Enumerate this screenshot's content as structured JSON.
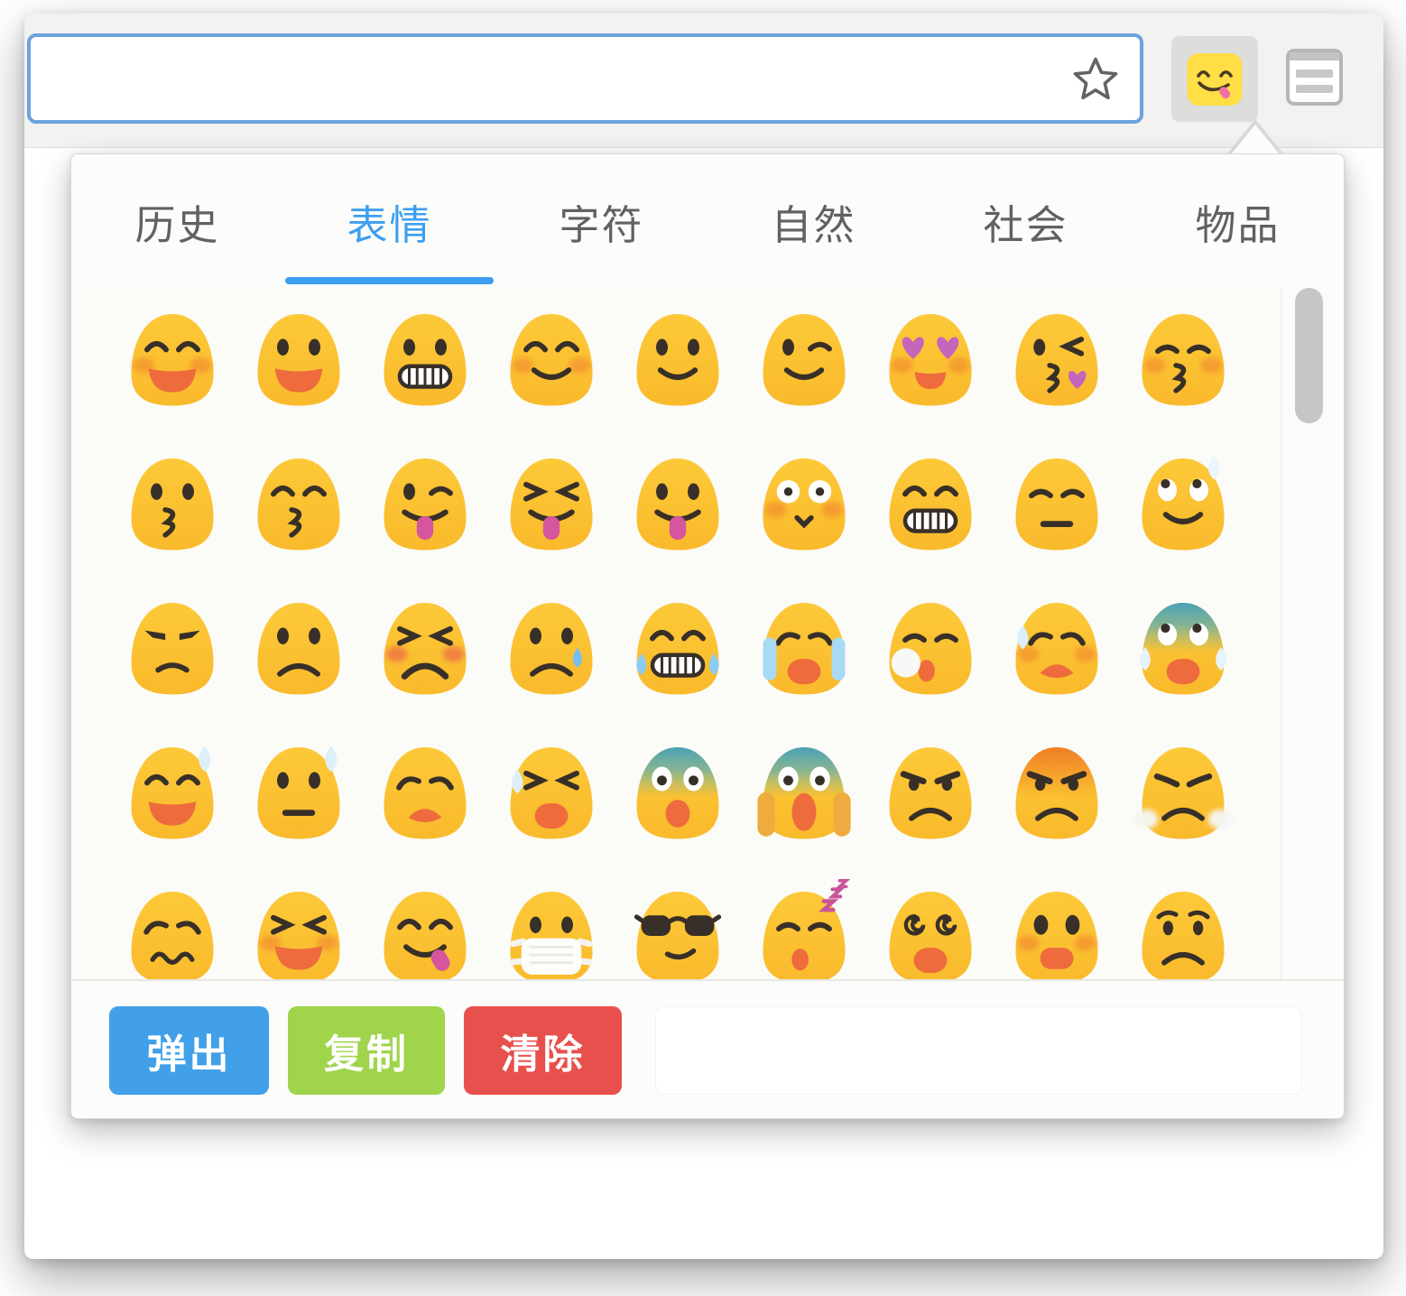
{
  "browser": {
    "toolbar": {
      "address_bar": {
        "value": "",
        "placeholder": ""
      },
      "bookmark_star_icon": "star-outline",
      "extension_button": {
        "icon": "emoji-face-tongue",
        "active": true
      },
      "menu_button": {
        "icon": "browser-menu"
      }
    }
  },
  "popup": {
    "accent_color": "#3D9FF0",
    "tabs": [
      {
        "label": "历史",
        "active": false
      },
      {
        "label": "表情",
        "active": true
      },
      {
        "label": "字符",
        "active": false
      },
      {
        "label": "自然",
        "active": false
      },
      {
        "label": "社会",
        "active": false
      },
      {
        "label": "物品",
        "active": false
      }
    ],
    "grid": {
      "columns": 9,
      "emojis": [
        {
          "char": "😄",
          "name": "smiling-face-open-mouth-smiling-eyes",
          "eyes": "happy",
          "mouth": "open-smile",
          "extras": [
            "blush"
          ]
        },
        {
          "char": "😃",
          "name": "smiling-face-open-mouth",
          "eyes": "oval",
          "mouth": "open-smile",
          "extras": []
        },
        {
          "char": "😀",
          "name": "grinning-face",
          "eyes": "oval",
          "mouth": "teeth",
          "extras": []
        },
        {
          "char": "😊",
          "name": "smiling-face-smiling-eyes",
          "eyes": "happy",
          "mouth": "smile",
          "extras": [
            "blush"
          ]
        },
        {
          "char": "☺",
          "name": "relaxed-face",
          "eyes": "oval",
          "mouth": "smile",
          "extras": []
        },
        {
          "char": "😉",
          "name": "winking-face",
          "eyes": "wink",
          "mouth": "smile",
          "extras": []
        },
        {
          "char": "😍",
          "name": "heart-eyes-face",
          "eyes": "hearts",
          "mouth": "open-smile-small",
          "extras": [
            "blush"
          ]
        },
        {
          "char": "😘",
          "name": "face-blowing-kiss",
          "eyes": "wink-kiss",
          "mouth": "kiss",
          "extras": [
            "heart"
          ]
        },
        {
          "char": "😚",
          "name": "kissing-face-closed-eyes",
          "eyes": "closed",
          "mouth": "kiss",
          "extras": [
            "blush"
          ]
        },
        {
          "char": "😗",
          "name": "kissing-face",
          "eyes": "oval",
          "mouth": "kiss",
          "extras": []
        },
        {
          "char": "😙",
          "name": "kissing-face-smiling-eyes",
          "eyes": "happy",
          "mouth": "kiss",
          "extras": []
        },
        {
          "char": "😜",
          "name": "winking-face-tongue",
          "eyes": "wink",
          "mouth": "open-tongue",
          "extras": []
        },
        {
          "char": "😝",
          "name": "squinting-face-tongue",
          "eyes": "scrunch",
          "mouth": "open-tongue",
          "extras": []
        },
        {
          "char": "😛",
          "name": "face-with-tongue",
          "eyes": "oval",
          "mouth": "open-tongue",
          "extras": []
        },
        {
          "char": "😳",
          "name": "flushed-face",
          "eyes": "wide-white",
          "mouth": "v",
          "extras": [
            "blush"
          ]
        },
        {
          "char": "😁",
          "name": "beaming-face",
          "eyes": "happy",
          "mouth": "teeth",
          "extras": []
        },
        {
          "char": "😔",
          "name": "pensive-face",
          "eyes": "closed",
          "mouth": "flat",
          "extras": []
        },
        {
          "char": "😌",
          "name": "relieved-face",
          "eyes": "look-up",
          "mouth": "smile",
          "extras": [
            "sweat-top"
          ]
        },
        {
          "char": "😒",
          "name": "unamused-face",
          "eyes": "half-lid",
          "mouth": "small-frown",
          "extras": []
        },
        {
          "char": "😞",
          "name": "disappointed-face",
          "eyes": "oval",
          "mouth": "frown",
          "extras": []
        },
        {
          "char": "😣",
          "name": "persevering-face",
          "eyes": "scrunch",
          "mouth": "deep-frown",
          "extras": [
            "blush-red"
          ]
        },
        {
          "char": "😢",
          "name": "crying-face",
          "eyes": "oval",
          "mouth": "frown",
          "extras": [
            "tear-right"
          ]
        },
        {
          "char": "😂",
          "name": "face-tears-of-joy",
          "eyes": "happy",
          "mouth": "teeth",
          "extras": [
            "tears-both"
          ]
        },
        {
          "char": "😭",
          "name": "loudly-crying-face",
          "eyes": "sad-closed",
          "mouth": "open-cry",
          "extras": [
            "tear-streams"
          ]
        },
        {
          "char": "😪",
          "name": "sleepy-face",
          "eyes": "closed",
          "mouth": "open-small",
          "extras": [
            "bubble"
          ]
        },
        {
          "char": "😥",
          "name": "disappointed-relieved-face",
          "eyes": "sad-closed",
          "mouth": "open-frown",
          "extras": [
            "blush",
            "sweat-left"
          ]
        },
        {
          "char": "😰",
          "name": "anxious-face-sweat",
          "eyes": "look-up",
          "mouth": "open-cry",
          "extras": [
            "blue-top",
            "side-sweat"
          ]
        },
        {
          "char": "😅",
          "name": "grinning-face-sweat",
          "eyes": "happy",
          "mouth": "open-smile",
          "extras": [
            "sweat-right"
          ]
        },
        {
          "char": "😓",
          "name": "downcast-face-sweat",
          "eyes": "oval",
          "mouth": "flat",
          "extras": [
            "sweat-right"
          ]
        },
        {
          "char": "😩",
          "name": "weary-face",
          "eyes": "sad-closed",
          "mouth": "open-frown",
          "extras": []
        },
        {
          "char": "😫",
          "name": "tired-face",
          "eyes": "scrunch",
          "mouth": "open-cry",
          "extras": [
            "sweat-left"
          ]
        },
        {
          "char": "😨",
          "name": "fearful-face",
          "eyes": "white-pupil",
          "mouth": "open-o",
          "extras": [
            "blue-top"
          ]
        },
        {
          "char": "😱",
          "name": "screaming-face",
          "eyes": "white-pupil",
          "mouth": "open-long",
          "extras": [
            "blue-top",
            "hands"
          ]
        },
        {
          "char": "😠",
          "name": "angry-face",
          "eyes": "angry",
          "mouth": "frown",
          "extras": []
        },
        {
          "char": "😡",
          "name": "pouting-face",
          "eyes": "angry",
          "mouth": "frown",
          "extras": [
            "red-top"
          ]
        },
        {
          "char": "😤",
          "name": "face-with-steam",
          "eyes": "angry-closed",
          "mouth": "frown",
          "extras": [
            "steam"
          ]
        },
        {
          "char": "😖",
          "name": "confounded-face",
          "eyes": "sad-closed",
          "mouth": "squiggle",
          "extras": []
        },
        {
          "char": "😆",
          "name": "grinning-squinting-face",
          "eyes": "scrunch",
          "mouth": "open-smile",
          "extras": [
            "blush"
          ]
        },
        {
          "char": "😋",
          "name": "face-savoring-food",
          "eyes": "happy",
          "mouth": "smile-tongue-side",
          "extras": []
        },
        {
          "char": "😷",
          "name": "face-with-mask",
          "eyes": "oval",
          "mouth": "mask",
          "extras": []
        },
        {
          "char": "😎",
          "name": "smiling-face-sunglasses",
          "eyes": "sunglasses",
          "mouth": "smirk",
          "extras": []
        },
        {
          "char": "😴",
          "name": "sleeping-face",
          "eyes": "closed",
          "mouth": "open-small",
          "extras": [
            "zzz"
          ]
        },
        {
          "char": "😵",
          "name": "dizzy-face",
          "eyes": "spiral",
          "mouth": "open-cry",
          "extras": []
        },
        {
          "char": "😲",
          "name": "astonished-face",
          "eyes": "oval-big",
          "mouth": "open-rect",
          "extras": [
            "blush"
          ]
        },
        {
          "char": "😟",
          "name": "worried-face",
          "eyes": "worried",
          "mouth": "frown",
          "extras": []
        }
      ]
    },
    "footer": {
      "buttons": [
        {
          "name": "popout",
          "label": "弹出",
          "color": "#41A0E8"
        },
        {
          "name": "copy",
          "label": "复制",
          "color": "#9FD44B"
        },
        {
          "name": "clear",
          "label": "清除",
          "color": "#E8504D"
        }
      ],
      "output_field": {
        "value": "",
        "placeholder": ""
      }
    }
  }
}
